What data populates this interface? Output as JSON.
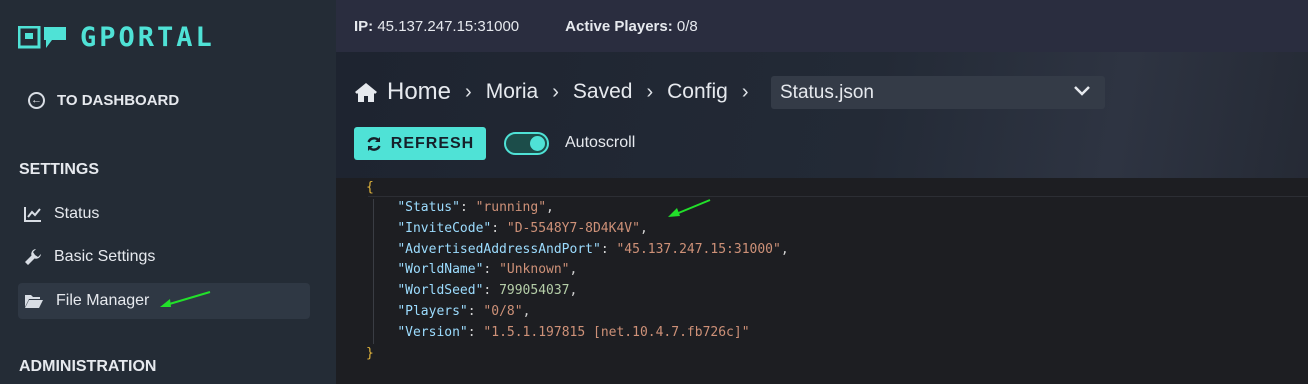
{
  "brand": {
    "name": "GPORTAL"
  },
  "sidebar": {
    "back_label": "TO DASHBOARD",
    "settings_heading": "SETTINGS",
    "items": [
      {
        "label": "Status",
        "icon": "chart-line-icon"
      },
      {
        "label": "Basic Settings",
        "icon": "wrench-icon"
      },
      {
        "label": "File Manager",
        "icon": "folder-open-icon",
        "active": true
      }
    ],
    "admin_heading": "ADMINISTRATION"
  },
  "topbar": {
    "ip_label": "IP:",
    "ip_value": "45.137.247.15:31000",
    "players_label": "Active Players:",
    "players_value": "0/8"
  },
  "breadcrumb": {
    "home": "Home",
    "items": [
      "Moria",
      "Saved",
      "Config"
    ]
  },
  "file_select": {
    "selected": "Status.json"
  },
  "toolbar": {
    "refresh_label": "REFRESH",
    "autoscroll_label": "Autoscroll",
    "autoscroll_on": true
  },
  "json_file": {
    "open_brace": "{",
    "close_brace": "}",
    "entries": [
      {
        "key": "\"Status\"",
        "value": "\"running\"",
        "type": "str",
        "comma": ","
      },
      {
        "key": "\"InviteCode\"",
        "value": "\"D-5548Y7-8D4K4V\"",
        "type": "str",
        "comma": ","
      },
      {
        "key": "\"AdvertisedAddressAndPort\"",
        "value": "\"45.137.247.15:31000\"",
        "type": "str",
        "comma": ","
      },
      {
        "key": "\"WorldName\"",
        "value": "\"Unknown\"",
        "type": "str",
        "comma": ","
      },
      {
        "key": "\"WorldSeed\"",
        "value": "799054037",
        "type": "num",
        "comma": ","
      },
      {
        "key": "\"Players\"",
        "value": "\"0/8\"",
        "type": "str",
        "comma": ","
      },
      {
        "key": "\"Version\"",
        "value": "\"1.5.1.197815 [net.10.4.7.fb726c]\"",
        "type": "str",
        "comma": ""
      }
    ]
  },
  "colors": {
    "accent": "#4fe2d6",
    "annotation_arrow": "#22e02a"
  }
}
